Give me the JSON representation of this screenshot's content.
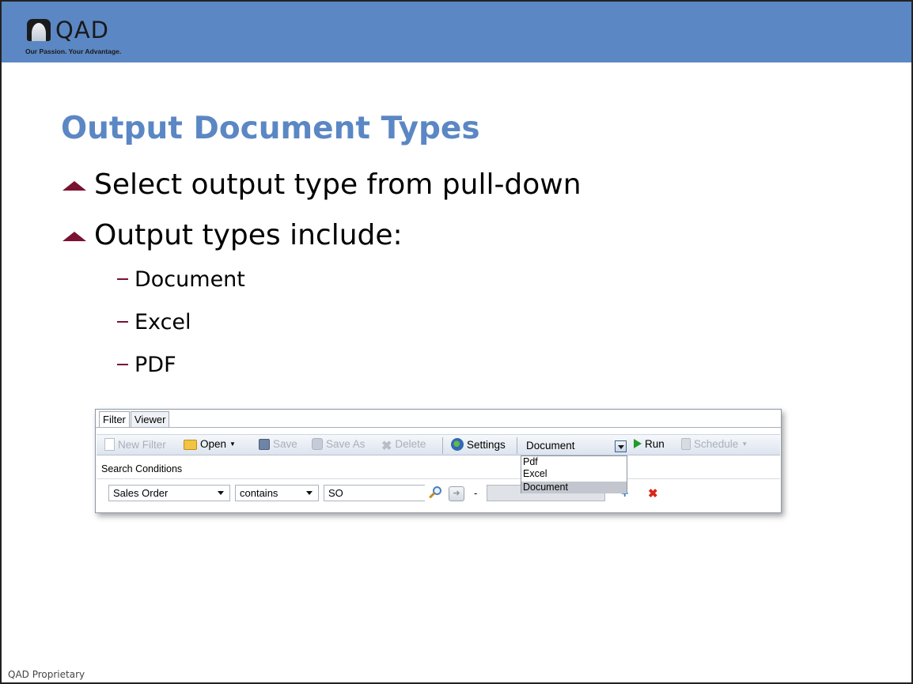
{
  "logo": {
    "name": "QAD",
    "tagline": "Our Passion. Your Advantage."
  },
  "colors": {
    "header_band": "#5b87c4",
    "title": "#5b87c4",
    "bullet_accent": "#7a1230"
  },
  "slide": {
    "title": "Output Document Types",
    "bullets": [
      "Select output type from pull-down",
      "Output types include:"
    ],
    "sub_bullets": [
      "Document",
      "Excel",
      "PDF"
    ],
    "footer": "QAD Proprietary"
  },
  "screenshot": {
    "tabs": [
      "Filter",
      "Viewer"
    ],
    "toolbar": {
      "new_filter": "New Filter",
      "open": "Open",
      "save": "Save",
      "save_as": "Save As",
      "delete": "Delete",
      "settings": "Settings",
      "output_type": "Document",
      "run": "Run",
      "schedule": "Schedule"
    },
    "output_options": [
      "Pdf",
      "Excel",
      "Document"
    ],
    "selected_option": "Document",
    "search_conditions_label": "Search Conditions",
    "condition": {
      "field": "Sales Order",
      "operator": "contains",
      "value": "SO",
      "range_separator": "-"
    },
    "icons": {
      "new_filter": "new-document-icon",
      "open": "open-folder-icon",
      "save": "save-disk-icon",
      "save_as": "save-as-icon",
      "delete": "delete-icon",
      "settings": "settings-gear-icon",
      "run": "run-play-icon",
      "schedule": "schedule-icon",
      "lookup": "search-icon",
      "add": "add-icon",
      "remove": "remove-icon"
    }
  }
}
